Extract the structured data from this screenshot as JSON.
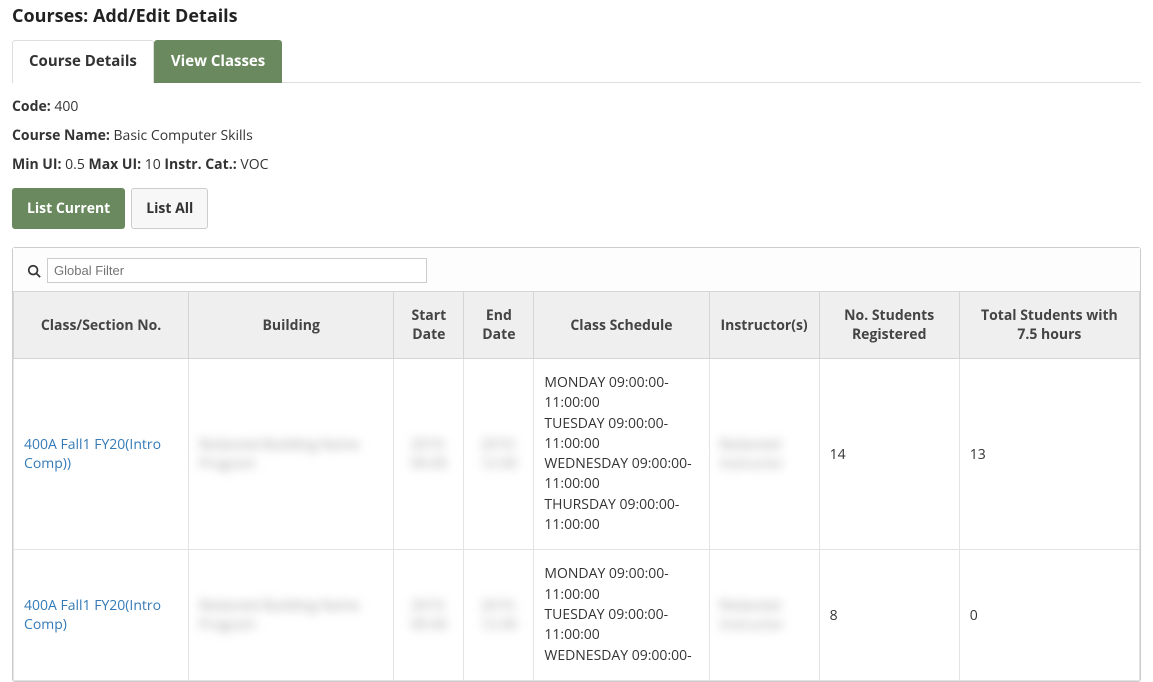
{
  "page_title": "Courses: Add/Edit Details",
  "tabs": {
    "details": "Course Details",
    "classes": "View Classes"
  },
  "course": {
    "code_label": "Code:",
    "code": "400",
    "name_label": "Course Name:",
    "name": "Basic Computer Skills",
    "minui_label": "Min UI:",
    "minui": "0.5",
    "maxui_label": "Max UI:",
    "maxui": "10",
    "instrcat_label": "Instr. Cat.:",
    "instrcat": "VOC"
  },
  "subtabs": {
    "current": "List Current",
    "all": "List All"
  },
  "filter": {
    "placeholder": "Global Filter",
    "value": ""
  },
  "columns": {
    "class_section": "Class/Section No.",
    "building": "Building",
    "start_date": "Start Date",
    "end_date": "End Date",
    "class_schedule": "Class Schedule",
    "instructors": "Instructor(s)",
    "registered": "No. Students Registered",
    "hours": "Total Students with 7.5 hours"
  },
  "rows": [
    {
      "class_section": "400A Fall1 FY20(Intro Comp))",
      "building": "Redacted Building Name Program",
      "start_date": "2019-09-00",
      "end_date": "2019-12-00",
      "schedule": [
        "MONDAY 09:00:00-11:00:00",
        "TUESDAY 09:00:00-11:00:00",
        "WEDNESDAY 09:00:00-11:00:00",
        "THURSDAY 09:00:00-11:00:00"
      ],
      "instructors": "Redacted Instructor",
      "registered": "14",
      "hours": "13"
    },
    {
      "class_section": "400A Fall1 FY20(Intro Comp)",
      "building": "Redacted Building Name Program",
      "start_date": "2019-09-00",
      "end_date": "2019-12-00",
      "schedule": [
        "MONDAY 09:00:00-11:00:00",
        "TUESDAY 09:00:00-11:00:00",
        "WEDNESDAY 09:00:00-"
      ],
      "instructors": "Redacted Instructor",
      "registered": "8",
      "hours": "0"
    }
  ]
}
